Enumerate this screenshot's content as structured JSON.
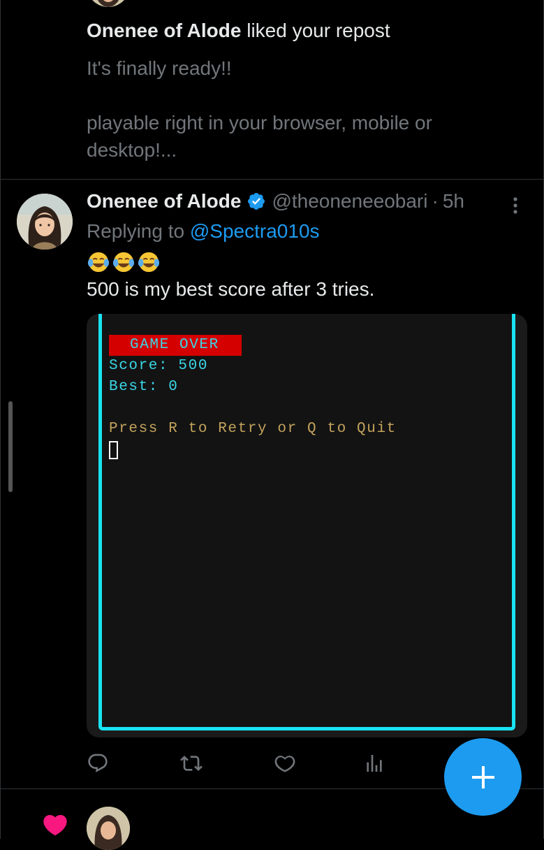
{
  "notification": {
    "actor": "Onenee of Alode",
    "action": " liked your repost",
    "body_line1": "It's finally ready!!",
    "body_line2": "playable right in your browser, mobile or desktop!..."
  },
  "tweet": {
    "author_name": "Onenee of Alode",
    "author_handle": "@theoneneeobari",
    "separator": "·",
    "time": "5h",
    "replying_prefix": "Replying to ",
    "replying_to": "@Spectra010s",
    "emojis": [
      "face-with-tears-of-joy",
      "face-with-tears-of-joy",
      "face-with-tears-of-joy"
    ],
    "text": "500 is my best score after 3 tries."
  },
  "game_screen": {
    "title": "GAME OVER",
    "score_line": "Score: 500",
    "best_line": "Best: 0",
    "prompt": "Press R to Retry or Q to Quit",
    "colors": {
      "border": "#19e3f2",
      "banner": "#d40000",
      "text_cyan": "#3ad6e6",
      "text_gold": "#c2a25c"
    }
  },
  "actions": {
    "icons": [
      "reply-icon",
      "retweet-icon",
      "like-icon",
      "views-icon"
    ]
  },
  "compose_button": {
    "icon": "plus-icon",
    "color": "#1d9bf0"
  },
  "accent_colors": {
    "link": "#1d9bf0",
    "secondary_text": "#71767b",
    "like_heart": "#f91880"
  }
}
